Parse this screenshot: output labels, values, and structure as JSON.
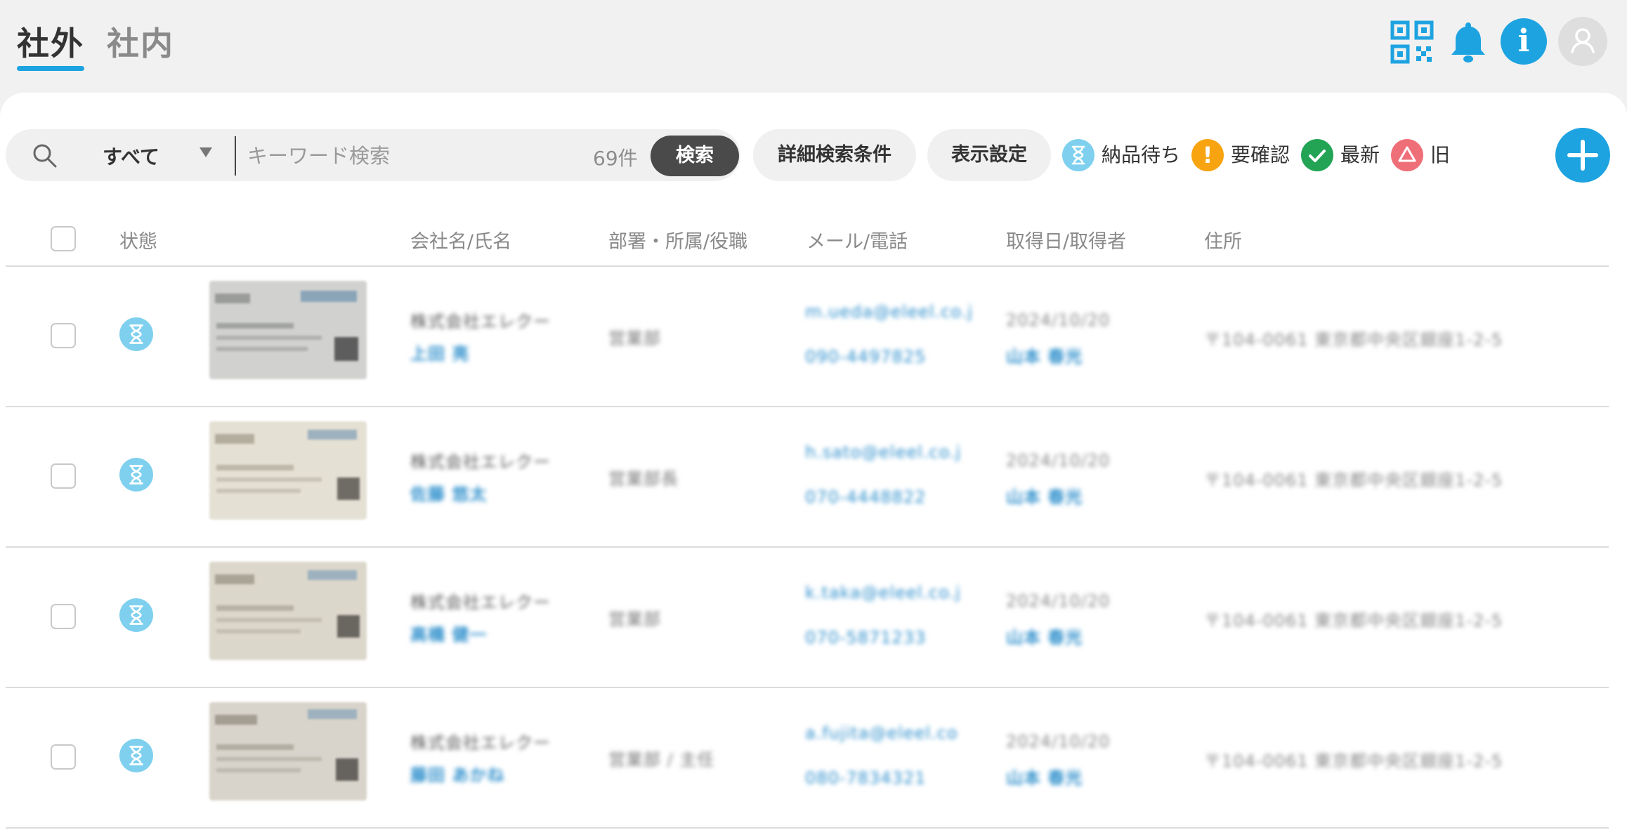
{
  "tabs": {
    "outside": "社外",
    "inside": "社内"
  },
  "colors": {
    "accent": "#1ea3e1",
    "pending": "#7fd0ef",
    "confirm": "#f7a410",
    "latest": "#23a455",
    "old": "#ef6f78"
  },
  "search": {
    "scope": "すべて",
    "placeholder": "キーワード検索",
    "count": "69件",
    "button": "検索"
  },
  "toolbar": {
    "advanced": "詳細検索条件",
    "display": "表示設定"
  },
  "legend": {
    "pending": "納品待ち",
    "confirm": "要確認",
    "latest": "最新",
    "old": "旧",
    "confirm_glyph": "!"
  },
  "table": {
    "headers": {
      "status": "状態",
      "company": "会社名/氏名",
      "dept": "部署・所属/役職",
      "contact": "メール/電話",
      "acquired": "取得日/取得者",
      "address": "住所"
    },
    "rows": [
      {
        "company": "株式会社エレクー",
        "name": "上田 亮",
        "dept": "営業部",
        "email": "m.ueda@eleel.co.j",
        "phone": "090-4497825",
        "date": "2024/10/20",
        "owner": "山本 春光",
        "address": "〒104-0061 東京都中央区銀座1-2-5"
      },
      {
        "company": "株式会社エレクー",
        "name": "佐藤 悠太",
        "dept": "営業部長",
        "email": "h.sato@eleel.co.j",
        "phone": "070-4448822",
        "date": "2024/10/20",
        "owner": "山本 春光",
        "address": "〒104-0061 東京都中央区銀座1-2-5"
      },
      {
        "company": "株式会社エレクー",
        "name": "高橋 健一",
        "dept": "営業部",
        "email": "k.taka@eleel.co.j",
        "phone": "070-5871233",
        "date": "2024/10/20",
        "owner": "山本 春光",
        "address": "〒104-0061 東京都中央区銀座1-2-5"
      },
      {
        "company": "株式会社エレクー",
        "name": "藤田 あかね",
        "dept": "営業部 / 主任",
        "email": "a.fujita@eleel.co",
        "phone": "080-7834321",
        "date": "2024/10/20",
        "owner": "山本 春光",
        "address": "〒104-0061 東京都中央区銀座1-2-5"
      }
    ]
  }
}
